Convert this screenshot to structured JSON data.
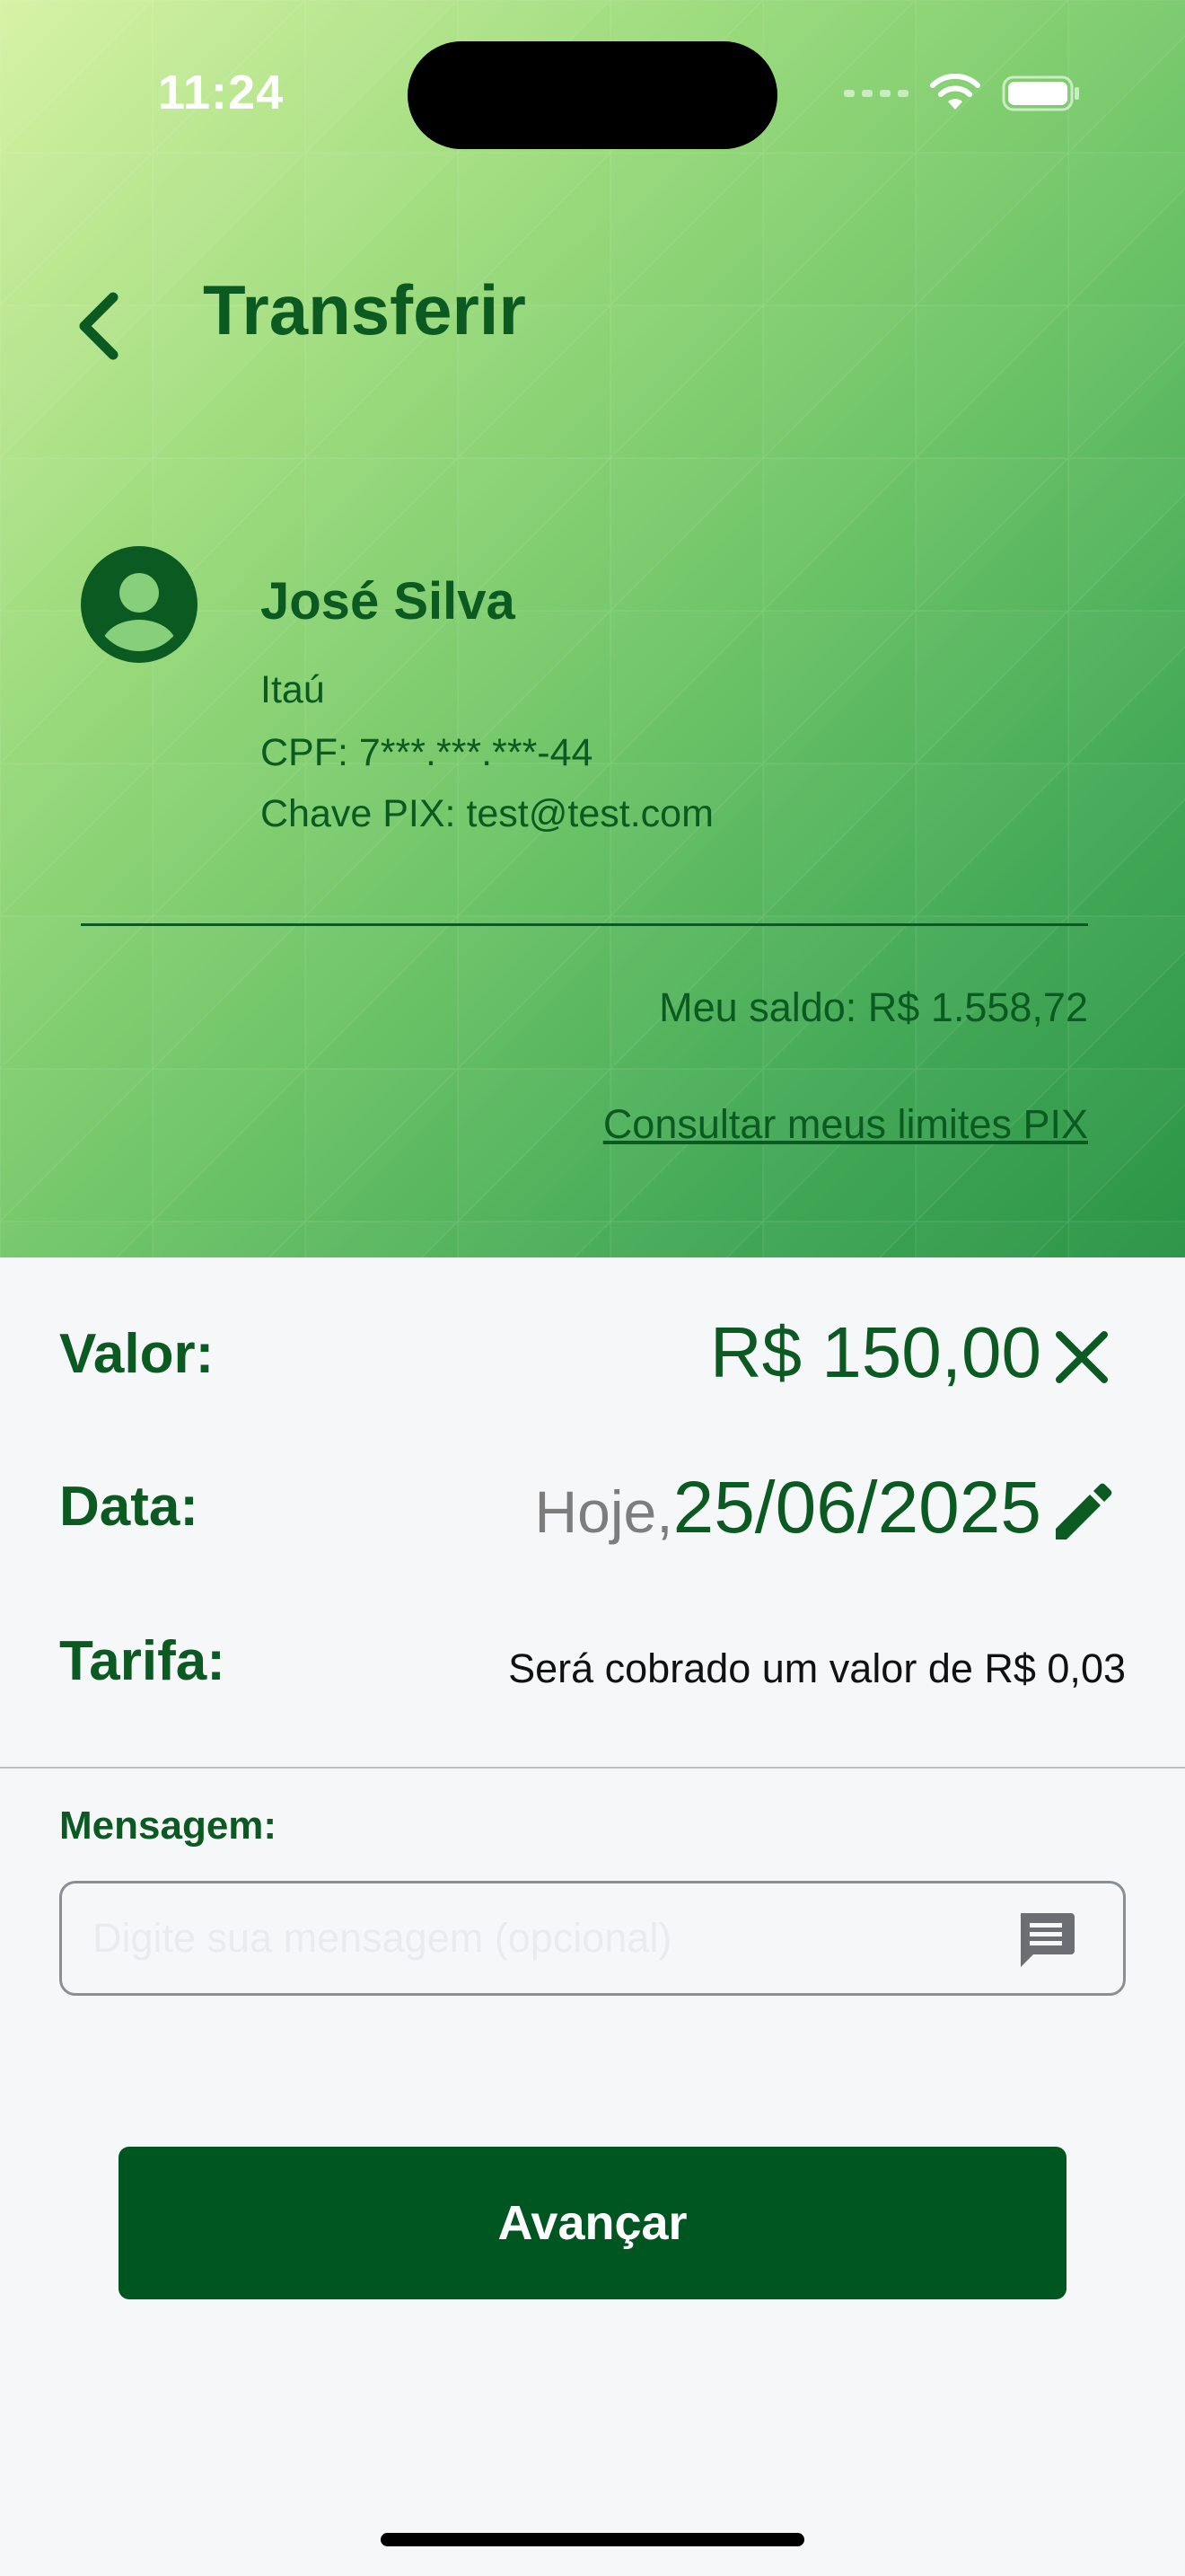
{
  "status_bar": {
    "time": "11:24"
  },
  "header": {
    "title": "Transferir"
  },
  "recipient": {
    "name": "José Silva",
    "bank": "Itaú",
    "cpf": "CPF: 7***.***.***-44",
    "pix_key": "Chave PIX: test@test.com"
  },
  "account": {
    "balance": "Meu saldo:  R$ 1.558,72",
    "limits_link": "Consultar meus limites PIX"
  },
  "form": {
    "valor_label": "Valor:",
    "valor_value": "R$ 150,00",
    "data_label": "Data:",
    "data_today": "Hoje,",
    "data_date": "25/06/2025",
    "tarifa_label": "Tarifa:",
    "tarifa_text": "Será cobrado um valor de R$ 0,03",
    "message_label": "Mensagem:",
    "message_placeholder": "Digite sua mensagem (opcional)",
    "submit_label": "Avançar"
  },
  "colors": {
    "primary": "#005620",
    "text_green": "#0b5a22",
    "background": "#f6f7f9"
  },
  "icons": {
    "back": "chevron-left-icon",
    "avatar": "user-avatar-icon",
    "clear": "close-icon",
    "edit": "pencil-icon",
    "message": "chat-bubble-icon",
    "wifi": "wifi-icon",
    "battery": "battery-icon"
  }
}
